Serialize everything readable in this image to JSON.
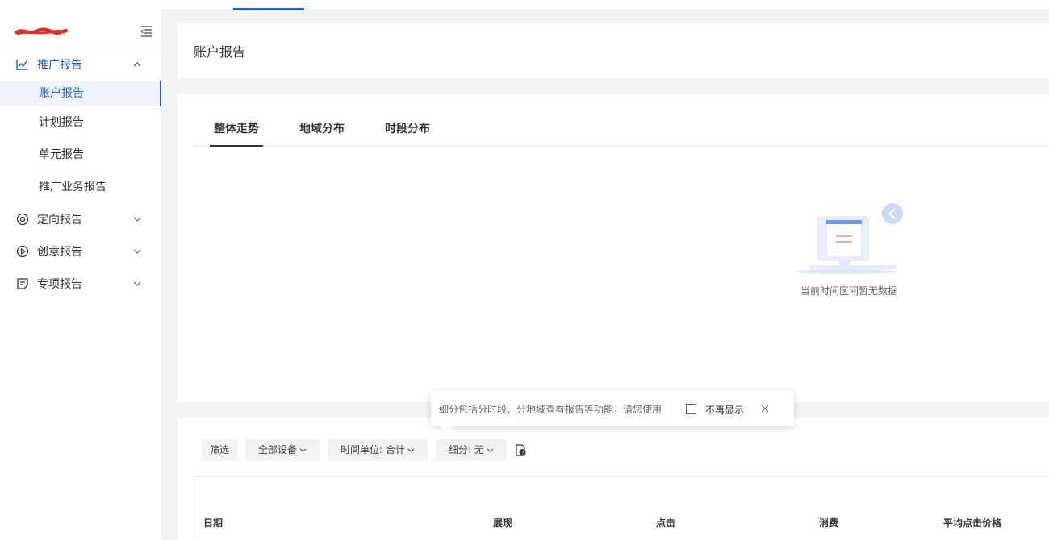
{
  "sidebar": {
    "groups": [
      {
        "label": "推广报告",
        "expanded": true,
        "icon": "line-chart-icon"
      },
      {
        "label": "定向报告",
        "expanded": false,
        "icon": "target-icon"
      },
      {
        "label": "创意报告",
        "expanded": false,
        "icon": "play-circle-icon"
      },
      {
        "label": "专项报告",
        "expanded": false,
        "icon": "document-icon"
      }
    ],
    "items": [
      "账户报告",
      "计划报告",
      "单元报告",
      "推广业务报告"
    ],
    "active_item": "账户报告"
  },
  "header": {
    "title": "账户报告"
  },
  "trend": {
    "tabs": [
      "整体走势",
      "地域分布",
      "时段分布"
    ],
    "active_tab": "整体走势",
    "empty_text": "当前时间区间暂无数据"
  },
  "filters": {
    "filter_label": "筛选",
    "device": "全部设备",
    "time_unit": "时间单位: 合计",
    "breakdown": "细分: 无"
  },
  "tooltip": {
    "text": "细分包括分时段、分地域查看报告等功能，请您使用",
    "checkbox_label": "不再显示"
  },
  "table": {
    "columns": [
      "日期",
      "展现",
      "点击",
      "消费",
      "平均点击价格"
    ]
  },
  "colors": {
    "accent": "#1f5ecc",
    "background": "#f2f3f5",
    "scribble": "#e0302a"
  }
}
